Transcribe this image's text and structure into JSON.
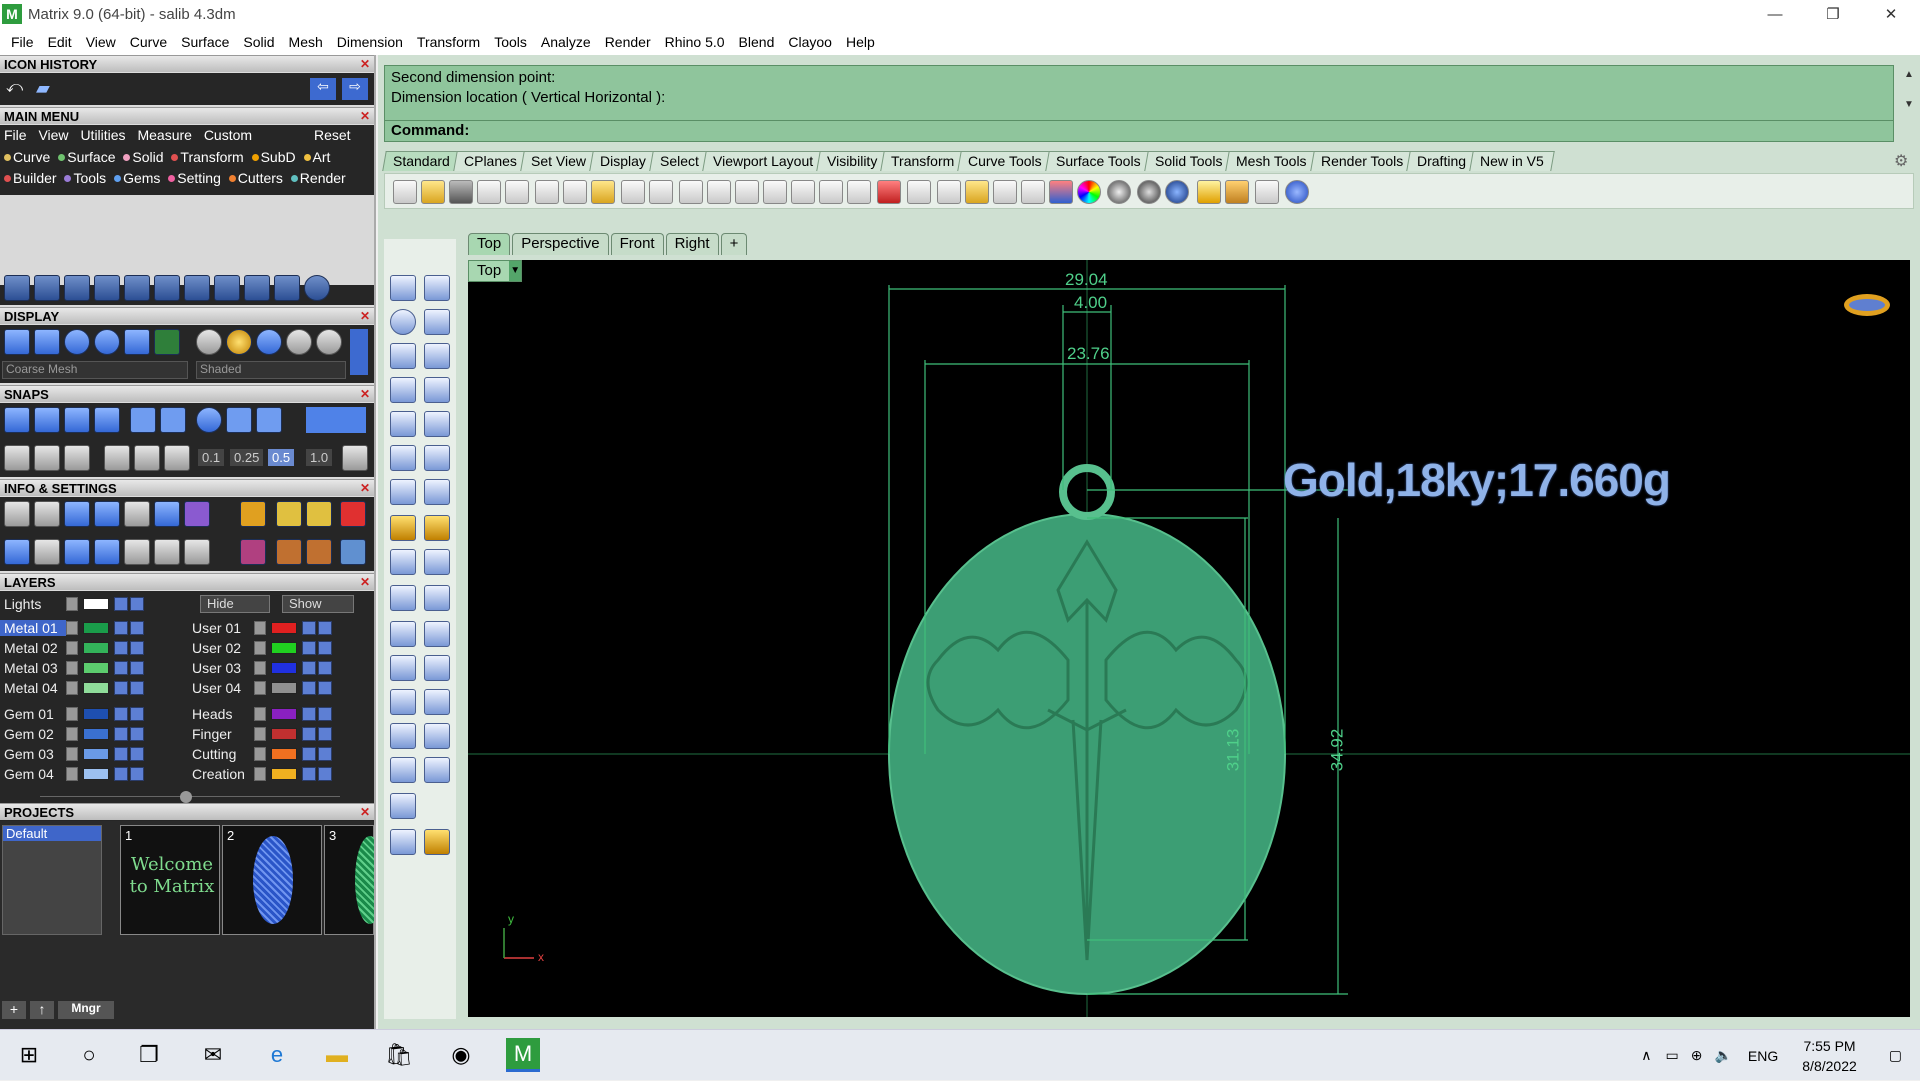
{
  "window": {
    "title": "Matrix 9.0 (64-bit) - salib 4.3dm",
    "minimize": "—",
    "restore": "❐",
    "close": "✕"
  },
  "menu": [
    "File",
    "Edit",
    "View",
    "Curve",
    "Surface",
    "Solid",
    "Mesh",
    "Dimension",
    "Transform",
    "Tools",
    "Analyze",
    "Render",
    "Rhino 5.0",
    "Blend",
    "Clayoo",
    "Help"
  ],
  "left": {
    "icon_history": "ICON HISTORY",
    "main_menu": "MAIN MENU",
    "main_menu_items": [
      "File",
      "View",
      "Utilities",
      "Measure",
      "Custom"
    ],
    "reset": "Reset",
    "row1": [
      {
        "label": "Curve",
        "color": "#e0c060"
      },
      {
        "label": "Surface",
        "color": "#6fc26f"
      },
      {
        "label": "Solid",
        "color": "#f0a0c0"
      },
      {
        "label": "Transform",
        "color": "#e05050"
      },
      {
        "label": "SubD",
        "color": "#f0a000"
      },
      {
        "label": "Art",
        "color": "#f0c040"
      }
    ],
    "row2": [
      {
        "label": "Builder",
        "color": "#e05050"
      },
      {
        "label": "Tools",
        "color": "#9a7cd8"
      },
      {
        "label": "Gems",
        "color": "#5fa0f0"
      },
      {
        "label": "Setting",
        "color": "#f060a0"
      },
      {
        "label": "Cutters",
        "color": "#f08030"
      },
      {
        "label": "Render",
        "color": "#60c0c0"
      }
    ],
    "display": "DISPLAY",
    "mesh_select": "Coarse Mesh",
    "shade_select": "Shaded",
    "snaps": "SNAPS",
    "snap_values": [
      "0.1",
      "0.25",
      "0.5",
      "1.0"
    ],
    "info_settings": "INFO & SETTINGS",
    "layers": "LAYERS",
    "lights": "Lights",
    "hide": "Hide",
    "show": "Show",
    "layers_left": [
      {
        "name": "Metal 01",
        "color": "#1a9c4a"
      },
      {
        "name": "Metal 02",
        "color": "#33b35a"
      },
      {
        "name": "Metal 03",
        "color": "#5ccc6e"
      },
      {
        "name": "Metal 04",
        "color": "#8fdc9a"
      },
      {
        "name": "Gem 01",
        "color": "#1e4fb0"
      },
      {
        "name": "Gem 02",
        "color": "#3a70d0"
      },
      {
        "name": "Gem 03",
        "color": "#6a9ae6"
      },
      {
        "name": "Gem 04",
        "color": "#9cc0f0"
      }
    ],
    "layers_right": [
      {
        "name": "User 01",
        "color": "#e02020"
      },
      {
        "name": "User 02",
        "color": "#20d020"
      },
      {
        "name": "User 03",
        "color": "#2030e0"
      },
      {
        "name": "User 04",
        "color": "#909090"
      },
      {
        "name": "Heads",
        "color": "#8a20c0"
      },
      {
        "name": "Finger",
        "color": "#c03030"
      },
      {
        "name": "Cutting",
        "color": "#f07020"
      },
      {
        "name": "Creation",
        "color": "#f0b020"
      }
    ],
    "projects": "PROJECTS",
    "project_default": "Default",
    "thumbs": [
      {
        "num": "1",
        "text": "Welcome to Matrix"
      },
      {
        "num": "2",
        "text": ""
      },
      {
        "num": "3",
        "text": ""
      }
    ],
    "mngr": "Mngr"
  },
  "command": {
    "line1": "Second dimension point:",
    "line2": "Dimension location ( Vertical  Horizontal ):",
    "prompt": "Command:"
  },
  "toolbar_tabs": [
    "Standard",
    "CPlanes",
    "Set View",
    "Display",
    "Select",
    "Viewport Layout",
    "Visibility",
    "Transform",
    "Curve Tools",
    "Surface Tools",
    "Solid Tools",
    "Mesh Tools",
    "Render Tools",
    "Drafting",
    "New in V5"
  ],
  "view_tabs": [
    "Top",
    "Perspective",
    "Front",
    "Right",
    "+"
  ],
  "viewport": {
    "label": "Top",
    "weight_text": "Gold,18ky;17.660g",
    "dims": {
      "d1": "29.04",
      "d2": "4.00",
      "d3": "23.76",
      "d4": "31.13",
      "d5": "34.92"
    },
    "axis_y": "y",
    "axis_x": "x"
  },
  "taskbar": {
    "lang": "ENG",
    "time": "7:55 PM",
    "date": "8/8/2022"
  }
}
